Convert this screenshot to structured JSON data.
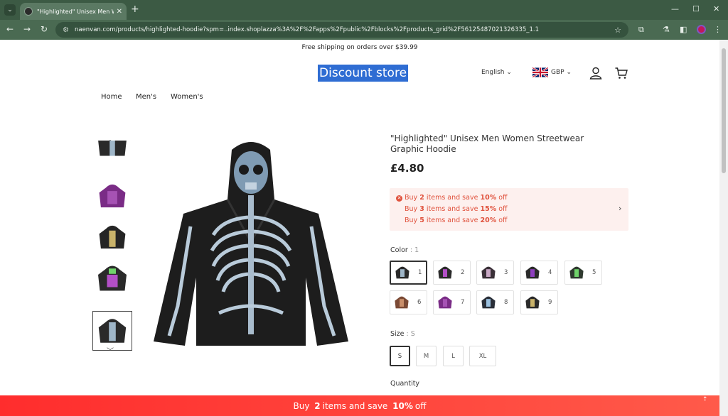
{
  "browser": {
    "tab_title": "\"Highlighted\" Unisex Men Wo",
    "url": "naenvan.com/products/highlighted-hoodie?spm=..index.shoplazza%3A%2F%2Fapps%2Fpublic%2Fblocks%2Fproducts_grid%2F56125487021326335_1.1"
  },
  "announcement": "Free shipping on orders over $39.99",
  "header": {
    "logo": "Discount store",
    "language": "English",
    "currency": "GBP"
  },
  "menu": [
    "Home",
    "Men's",
    "Women's"
  ],
  "product": {
    "title": "\"Highlighted\" Unisex Men Women Streetwear Graphic Hoodie",
    "price": "£4.80",
    "promo": [
      {
        "pre": "Buy",
        "qty": "2",
        "mid": "items and save",
        "pct": "10%",
        "post": "off"
      },
      {
        "pre": "Buy",
        "qty": "3",
        "mid": "items and save",
        "pct": "15%",
        "post": "off"
      },
      {
        "pre": "Buy",
        "qty": "5",
        "mid": "items and save",
        "pct": "20%",
        "post": "off"
      }
    ],
    "color_label": "Color",
    "color_value": "1",
    "colors": [
      {
        "num": "1",
        "body": "#2a2a2a",
        "accent": "#9fb6c8"
      },
      {
        "num": "2",
        "body": "#2a2a2a",
        "accent": "#b34fc7"
      },
      {
        "num": "3",
        "body": "#3a3038",
        "accent": "#c9a8c5"
      },
      {
        "num": "4",
        "body": "#2a2a2a",
        "accent": "#8e3fbf"
      },
      {
        "num": "5",
        "body": "#2f3a2f",
        "accent": "#6fd36a"
      },
      {
        "num": "6",
        "body": "#7b4a35",
        "accent": "#c98e6a"
      },
      {
        "num": "7",
        "body": "#7a2c86",
        "accent": "#a652b4"
      },
      {
        "num": "8",
        "body": "#2a2f38",
        "accent": "#9bc1e0"
      },
      {
        "num": "9",
        "body": "#2a2a2a",
        "accent": "#c9b36a"
      }
    ],
    "size_label": "Size",
    "size_value": "S",
    "sizes": [
      "S",
      "M",
      "L",
      "XL"
    ],
    "quantity_label": "Quantity"
  },
  "bottom_bar": {
    "pre": "Buy",
    "qty": "2",
    "mid": "items and save",
    "pct": "10%",
    "post": "off"
  },
  "colors": {
    "chrome": "#3c5a44",
    "promo_text": "#e0523d",
    "promo_bg": "#fdf0ee",
    "bottom_bar": "#ff3b33",
    "logo_bg": "#2f6dd3"
  }
}
